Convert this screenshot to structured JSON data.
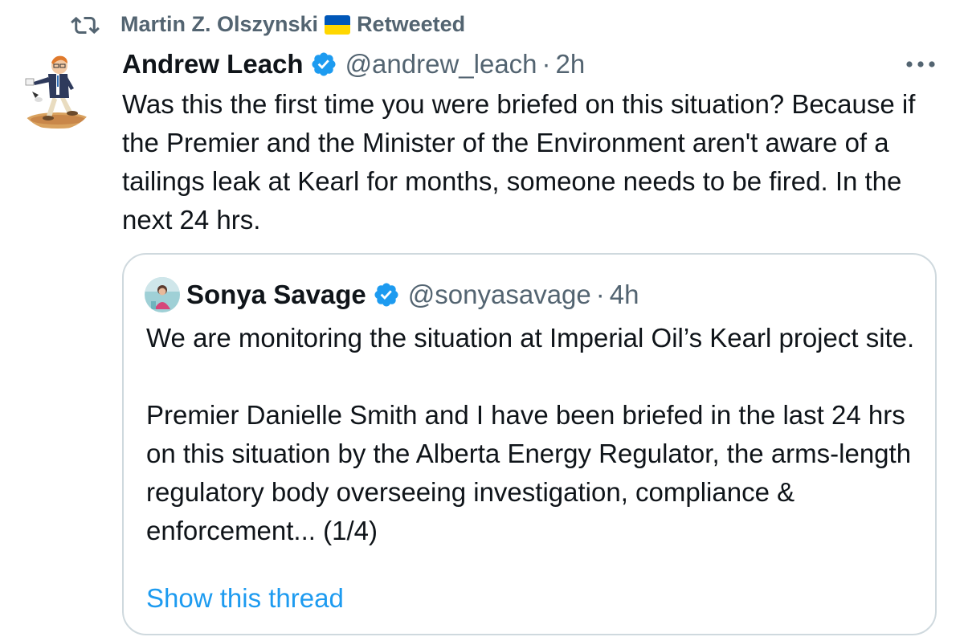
{
  "retweet": {
    "retweeter_name": "Martin Z. Olszynski",
    "label": "Retweeted"
  },
  "tweet": {
    "display_name": "Andrew Leach",
    "handle": "@andrew_leach",
    "separator": "·",
    "time": "2h",
    "text": "Was this the first time you were briefed on this situation? Because if the Premier and the Minister of the Environment aren't aware of a tailings leak at Kearl for months, someone needs to be fired. In the next 24 hrs."
  },
  "quote": {
    "display_name": "Sonya Savage",
    "handle": "@sonyasavage",
    "separator": "·",
    "time": "4h",
    "paragraph_1": "We are monitoring the situation at Imperial Oil’s Kearl project site.",
    "paragraph_2": "Premier Danielle Smith and I have been briefed in the last 24 hrs on this situation by the Alberta Energy Regulator, the arms-length regulatory body overseeing investigation, compliance & enforcement... (1/4)",
    "show_thread_label": "Show this thread"
  },
  "colors": {
    "text_primary": "#0f1419",
    "text_secondary": "#536471",
    "accent": "#1d9bf0",
    "border": "#cfd9de",
    "flag_blue": "#0057b8",
    "flag_yellow": "#ffd700"
  },
  "icons": {
    "retweet": "retweet-icon",
    "verified": "verified-badge-icon",
    "more": "more-options-icon",
    "flag": "ukraine-flag-icon"
  }
}
